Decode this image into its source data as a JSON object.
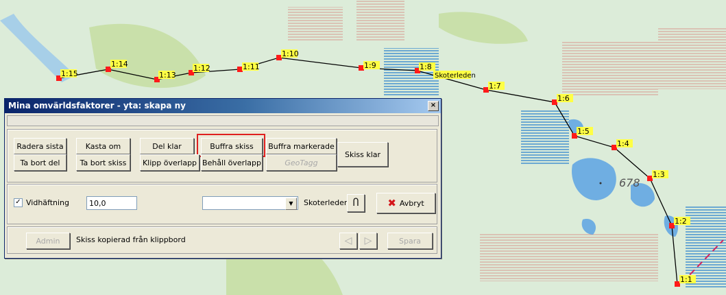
{
  "map": {
    "route_label": "Skoterleden",
    "elevation_label": "678",
    "waypoints": [
      {
        "label": "1:15"
      },
      {
        "label": "1:14"
      },
      {
        "label": "1:13"
      },
      {
        "label": "1:12"
      },
      {
        "label": "1:11"
      },
      {
        "label": "1:10"
      },
      {
        "label": "1:9"
      },
      {
        "label": "1:8"
      },
      {
        "label": "1:7"
      },
      {
        "label": "1:6"
      },
      {
        "label": "1:5"
      },
      {
        "label": "1:4"
      },
      {
        "label": "1:3"
      },
      {
        "label": "1:2"
      },
      {
        "label": "1:1"
      }
    ],
    "colors": {
      "route": "#000000",
      "marker": "#ff1a1a",
      "label_bg": "#ffff44",
      "water": "#5aa0d8",
      "forest": "#c8dfa8"
    }
  },
  "dialog": {
    "title": "Mina omvärldsfaktorer - yta: skapa ny",
    "close_symbol": "×",
    "row1": {
      "radera_sista": "Radera sista",
      "kasta_om": "Kasta om",
      "del_klar": "Del klar",
      "buffra_skiss": "Buffra skiss",
      "buffra_markerade": "Buffra markerade"
    },
    "row2": {
      "ta_bort_del": "Ta bort del",
      "ta_bort_skiss": "Ta bort skiss",
      "klipp_overlapp": "Klipp överlapp",
      "behall_overlapp": "Behåll överlapp",
      "geotagg": "GeoTagg"
    },
    "skiss_klar": "Skiss klar",
    "vidhaftning": {
      "checked": true,
      "check_symbol": "✓",
      "label": "Vidhäftning",
      "value": "10,0"
    },
    "dropdown_value": "",
    "dropdown_arrow": "▼",
    "skoterleder_label": "Skoterleder",
    "skoterleder_icon_glyph": "Ⴖ",
    "avbryt": {
      "icon": "✖",
      "label": "Avbryt"
    },
    "admin_label": "Admin",
    "status_text": "Skiss kopierad från klippbord",
    "nav_prev": "◁",
    "nav_next": "▷",
    "spara_label": "Spara"
  }
}
